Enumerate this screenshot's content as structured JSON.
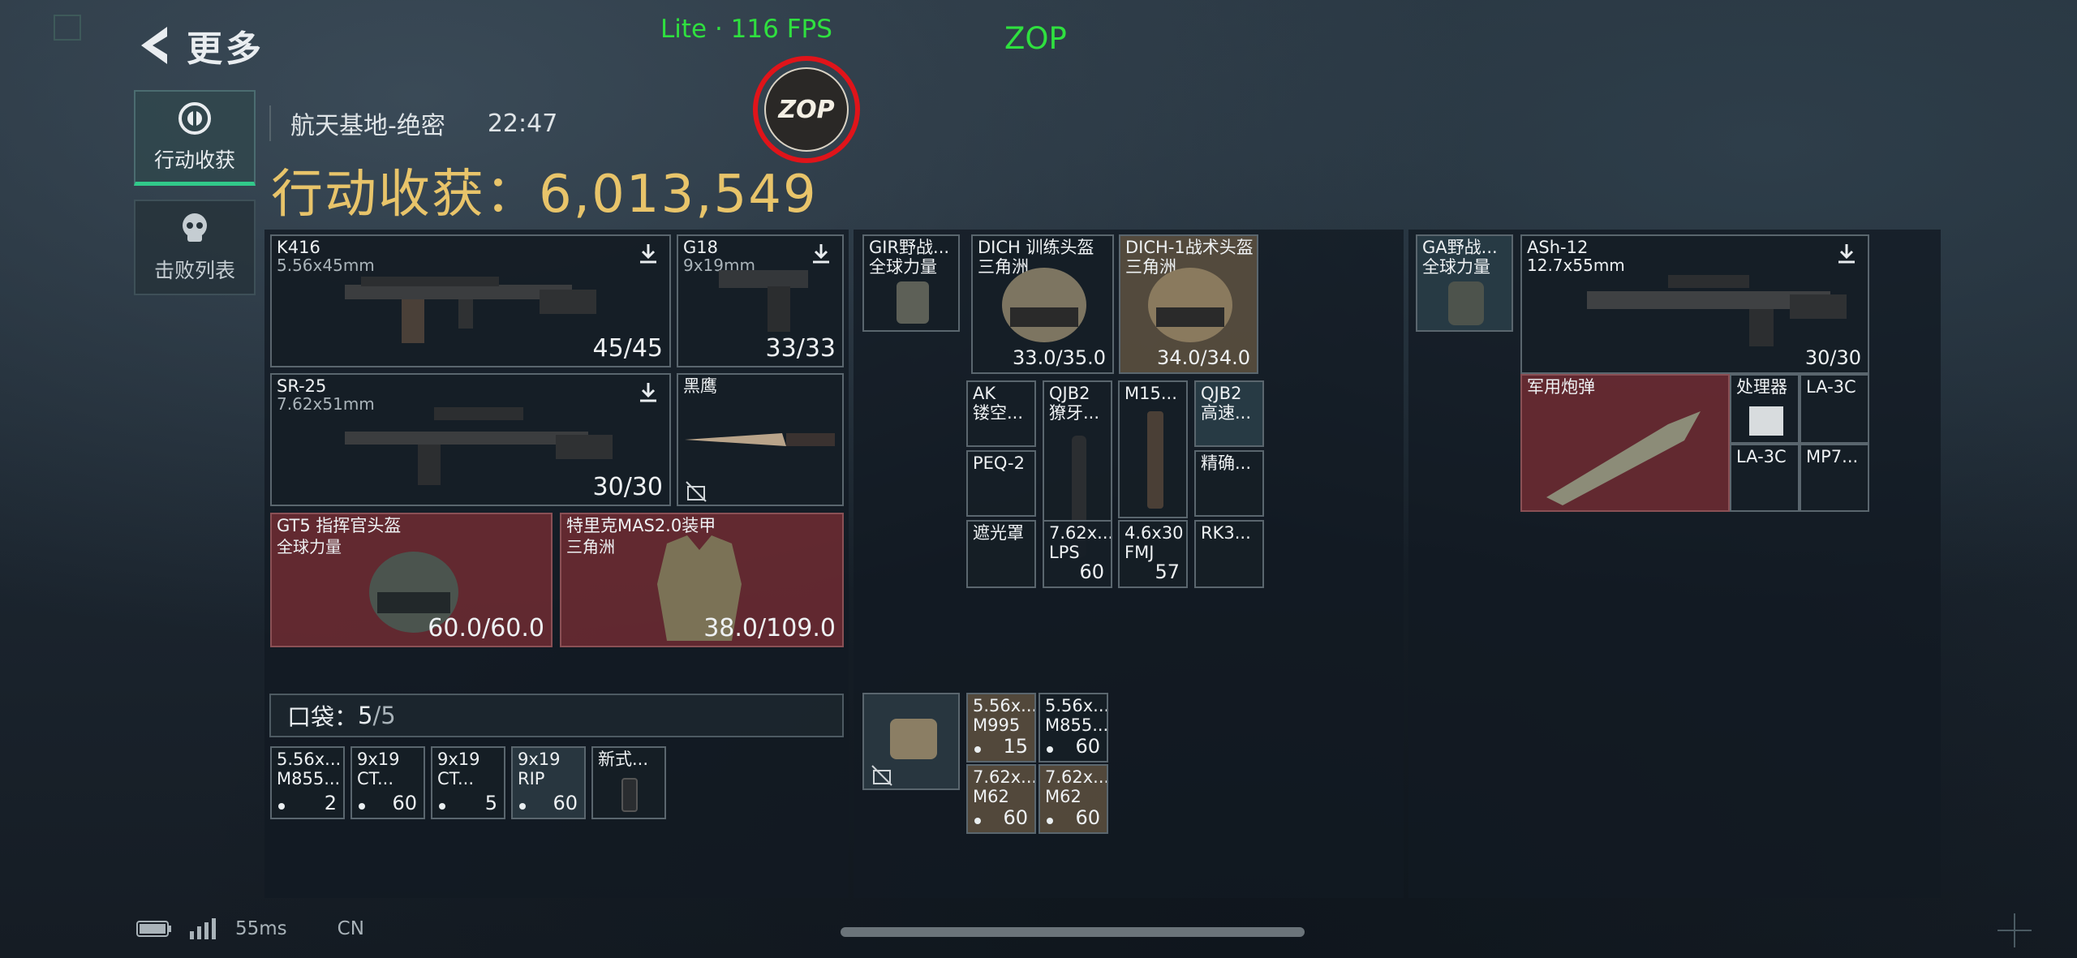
{
  "header": {
    "back_label": "更多",
    "fps_text": "Lite  ·  116 FPS",
    "overlay_label": "ZOP",
    "badge_text": "ZOP"
  },
  "tabs": [
    {
      "label": "行动收获",
      "icon": "eye-emblem-icon"
    },
    {
      "label": "击败列表",
      "icon": "skull-icon"
    }
  ],
  "match": {
    "map": "航天基地-绝密",
    "time": "22:47",
    "loot_label": "行动收获：",
    "loot_value": "6,013,549"
  },
  "loadout": {
    "primary": {
      "name": "K416",
      "caliber": "5.56x45mm",
      "ammo": "45/45"
    },
    "sidearm": {
      "name": "G18",
      "caliber": "9x19mm",
      "ammo": "33/33"
    },
    "secondary": {
      "name": "SR-25",
      "caliber": "7.62x51mm",
      "ammo": "30/30"
    },
    "melee": {
      "name": "黑鹰"
    },
    "helmet": {
      "name": "GT5 指挥官头盔",
      "tag": "全球力量",
      "durability": "60.0/60.0"
    },
    "armor": {
      "name": "特里克MAS2.0装甲",
      "tag": "三角洲",
      "durability": "38.0/109.0"
    }
  },
  "pocket": {
    "label": "口袋：",
    "count": "5",
    "capacity": "/5",
    "items": [
      {
        "l1": "5.56x...",
        "l2": "M855...",
        "qty": "2"
      },
      {
        "l1": "9x19",
        "l2": "CT...",
        "qty": "60"
      },
      {
        "l1": "9x19",
        "l2": "CT...",
        "qty": "5"
      },
      {
        "l1": "9x19",
        "l2": "RIP",
        "qty": "60"
      },
      {
        "l1": "新式...",
        "l2": "",
        "qty": ""
      }
    ]
  },
  "rig": {
    "vest": {
      "l1": "GIR野战...",
      "l2": "全球力量"
    },
    "helmet1": {
      "l1": "DICH 训练头盔",
      "l2": "三角洲",
      "val": "33.0/35.0"
    },
    "helmet2": {
      "l1": "DICH-1战术头盔",
      "l2": "三角洲",
      "val": "34.0/34.0"
    },
    "grid": [
      {
        "l1": "AK",
        "l2": "镂空...",
        "val": ""
      },
      {
        "l1": "QJB2",
        "l2": "獠牙...",
        "val": ""
      },
      {
        "l1": "M15...",
        "l2": "",
        "val": ""
      },
      {
        "l1": "QJB2",
        "l2": "高速...",
        "val": ""
      },
      {
        "l1": "PEQ-2",
        "l2": "",
        "val": ""
      },
      {
        "l1": "精确...",
        "l2": "",
        "val": ""
      },
      {
        "l1": "遮光罩",
        "l2": "",
        "val": ""
      },
      {
        "l1": "7.62x...",
        "l2": "LPS",
        "val": "60"
      },
      {
        "l1": "4.6x30",
        "l2": "FMJ",
        "val": "57"
      },
      {
        "l1": "RK3...",
        "l2": "",
        "val": ""
      }
    ],
    "ammo": [
      {
        "l1": "5.56x...",
        "l2": "M995",
        "qty": "15"
      },
      {
        "l1": "5.56x...",
        "l2": "M855...",
        "qty": "60"
      },
      {
        "l1": "7.62x...",
        "l2": "M62",
        "qty": "60"
      },
      {
        "l1": "7.62x...",
        "l2": "M62",
        "qty": "60"
      }
    ]
  },
  "backpack": {
    "bag": {
      "l1": "GA野战...",
      "l2": "全球力量"
    },
    "rifle": {
      "name": "ASh-12",
      "caliber": "12.7x55mm",
      "ammo": "30/30"
    },
    "items": [
      {
        "label": "军用炮弹"
      },
      {
        "label": "处理器"
      },
      {
        "label": "LA-3C"
      },
      {
        "label": "LA-3C"
      },
      {
        "label": "MP7..."
      }
    ]
  },
  "status": {
    "ping": "55ms",
    "region": "CN"
  }
}
